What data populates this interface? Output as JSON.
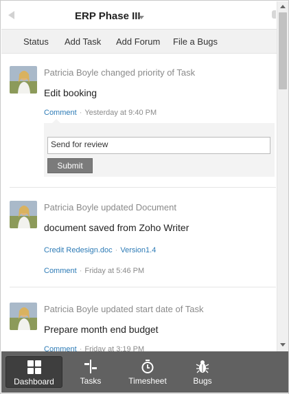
{
  "header": {
    "title": "ERP Phase III"
  },
  "actions": [
    {
      "label": "Status"
    },
    {
      "label": "Add Task"
    },
    {
      "label": "Add Forum"
    },
    {
      "label": "File a Bugs"
    }
  ],
  "feed": [
    {
      "headline": "Patricia Boyle changed priority of Task",
      "subject": "Edit booking",
      "comment_label": "Comment",
      "separator": "·",
      "time": "Yesterday at 9:40 PM",
      "reply": {
        "value": "Send for review",
        "submit_label": "Submit"
      }
    },
    {
      "headline": "Patricia Boyle updated Document",
      "subject": "document saved from Zoho Writer",
      "attachment": "Credit Redesign.doc",
      "separator": "·",
      "version": "Version1.4",
      "comment_label": "Comment",
      "time": "Friday at 5:46 PM"
    },
    {
      "headline": "Patricia Boyle updated start date of Task",
      "subject": "Prepare month end budget",
      "comment_label": "Comment",
      "separator": "·",
      "time": "Friday at 3:19 PM"
    }
  ],
  "bottom_nav": [
    {
      "label": "Dashboard",
      "icon": "dashboard-grid-icon",
      "active": true
    },
    {
      "label": "Tasks",
      "icon": "tasks-icon"
    },
    {
      "label": "Timesheet",
      "icon": "stopwatch-icon"
    },
    {
      "label": "Bugs",
      "icon": "bug-icon"
    }
  ],
  "colors": {
    "link": "#2d7bb6",
    "nav_background": "#616161",
    "nav_active": "#3e3e3e",
    "action_bar": "#f1f1f1",
    "submit_button": "#7b7b7b"
  }
}
